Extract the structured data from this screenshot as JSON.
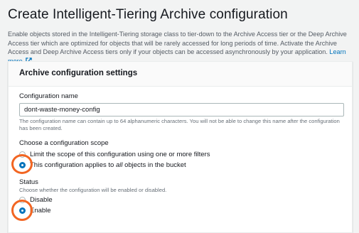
{
  "header": {
    "title": "Create Intelligent-Tiering Archive configuration",
    "description": "Enable objects stored in the Intelligent-Tiering storage class to tier-down to the Archive Access tier or the Deep Archive Access tier which are optimized for objects that will be rarely accessed for long periods of time. Activate the Archive Access and Deep Archive Access tiers only if your objects can be accessed asynchronously by your application.",
    "learn_more": "Learn more"
  },
  "panel": {
    "title": "Archive configuration settings",
    "config_name": {
      "label": "Configuration name",
      "value": "dont-waste-money-config",
      "hint": "The configuration name can contain up to 64 alphanumeric characters. You will not be able to change this name after the configuration has been created."
    },
    "scope": {
      "label": "Choose a configuration scope",
      "option_filter": "Limit the scope of this configuration using one or more filters",
      "option_all_prefix": "This configuration applies to ",
      "option_all_em": "all",
      "option_all_suffix": " objects in the bucket",
      "selected": "all"
    },
    "status": {
      "label": "Status",
      "hint": "Choose whether the configuration will be enabled or disabled.",
      "option_disable": "Disable",
      "option_enable": "Enable",
      "selected": "enable"
    }
  },
  "colors": {
    "accent": "#0073bb",
    "annotation": "#f26522",
    "background": "#f2f3f3"
  },
  "icons": {
    "external_link": "external-link-icon"
  }
}
